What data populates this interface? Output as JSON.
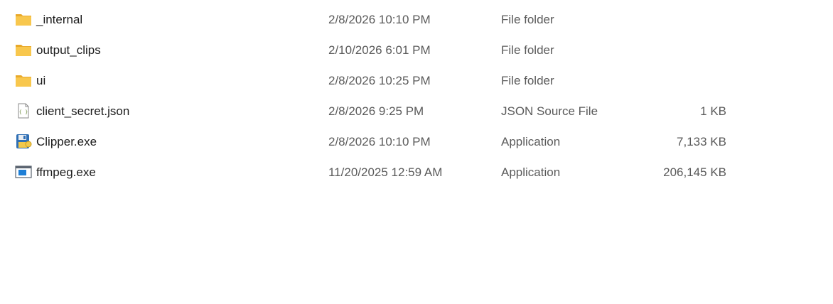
{
  "files": [
    {
      "name": "_internal",
      "date_modified": "2/8/2026 10:10 PM",
      "type": "File folder",
      "size": "",
      "icon": "folder-icon"
    },
    {
      "name": "output_clips",
      "date_modified": "2/10/2026 6:01 PM",
      "type": "File folder",
      "size": "",
      "icon": "folder-icon"
    },
    {
      "name": "ui",
      "date_modified": "2/8/2026 10:25 PM",
      "type": "File folder",
      "size": "",
      "icon": "folder-icon"
    },
    {
      "name": "client_secret.json",
      "date_modified": "2/8/2026 9:25 PM",
      "type": "JSON Source File",
      "size": "1 KB",
      "icon": "json-file-icon"
    },
    {
      "name": "Clipper.exe",
      "date_modified": "2/8/2026 10:10 PM",
      "type": "Application",
      "size": "7,133 KB",
      "icon": "floppy-disk-icon"
    },
    {
      "name": "ffmpeg.exe",
      "date_modified": "11/20/2025 12:59 AM",
      "type": "Application",
      "size": "206,145 KB",
      "icon": "application-window-icon"
    }
  ],
  "colors": {
    "folder_fill": "#F8C74D",
    "folder_back": "#E9A92A",
    "text_primary": "#1B1B1B",
    "text_secondary": "#5A5A5A"
  }
}
